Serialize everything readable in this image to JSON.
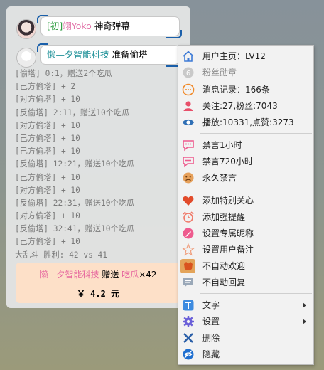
{
  "chat": {
    "messages": [
      {
        "tag": "[初]",
        "nick": "翊Yoko",
        "text": "神奇弹幕"
      },
      {
        "nick": "懒—夕智能科技",
        "text": "准备偷塔"
      }
    ],
    "log_lines": [
      "[偷塔] 0:1，赠送2个吃瓜",
      "[己方偷塔] + 2",
      "[对方偷塔] + 10",
      "[反偷塔] 2:11，赠送10个吃瓜",
      "[对方偷塔] + 10",
      "[己方偷塔] + 10",
      "[己方偷塔] + 10",
      "[反偷塔] 12:21，赠送10个吃瓜",
      "[己方偷塔] + 10",
      "[对方偷塔] + 10",
      "[反偷塔] 22:31，赠送10个吃瓜",
      "[对方偷塔] + 10",
      "[反偷塔] 32:41，赠送10个吃瓜",
      "[己方偷塔] + 10",
      "大乱斗 胜利: 42 vs 41"
    ],
    "gift": {
      "user": "懒—夕智能科技",
      "action": "赠送",
      "item": "吃瓜",
      "count": "×42",
      "amount": "￥ 4.2 元"
    }
  },
  "menu": {
    "items": [
      {
        "label": "用户主页：LV12",
        "icon": "home-icon",
        "color": "#3d7ad6"
      },
      {
        "label": "粉丝勋章",
        "icon": "medal-icon",
        "color": "#c8c8c8",
        "disabled": true
      },
      {
        "label": "消息记录：166条",
        "icon": "chat-log-icon",
        "color": "#f08a2b"
      },
      {
        "label": "关注:27,粉丝:7043",
        "icon": "user-icon",
        "color": "#e8506a"
      },
      {
        "label": "播放:10331,点赞:3273",
        "icon": "eye-icon",
        "color": "#2f6fb5"
      },
      {
        "label": "禁言1小时",
        "icon": "mute-icon",
        "color": "#ee5b8e"
      },
      {
        "label": "禁言720小时",
        "icon": "mute-long-icon",
        "color": "#ee5b8e"
      },
      {
        "label": "永久禁言",
        "icon": "ban-face-icon",
        "color": "#e6a05a"
      },
      {
        "label": "添加特别关心",
        "icon": "heart-icon",
        "color": "#e24b2b"
      },
      {
        "label": "添加强提醒",
        "icon": "alarm-icon",
        "color": "#f07a6a"
      },
      {
        "label": "设置专属昵称",
        "icon": "tag-icon",
        "color": "#ee5b8e"
      },
      {
        "label": "设置用户备注",
        "icon": "note-icon",
        "color": "#f0a080"
      },
      {
        "label": "不自动欢迎",
        "icon": "welcome-icon",
        "color": "#d9531e"
      },
      {
        "label": "不自动回复",
        "icon": "reply-icon",
        "color": "#9aa8b8"
      },
      {
        "label": "文字",
        "icon": "text-icon",
        "color": "#3d8be0",
        "submenu": true
      },
      {
        "label": "设置",
        "icon": "gear-icon",
        "color": "#6a5fd8",
        "submenu": true
      },
      {
        "label": "删除",
        "icon": "close-icon",
        "color": "#2a5fa8"
      },
      {
        "label": "隐藏",
        "icon": "hide-icon",
        "color": "#1f6fd0"
      }
    ]
  }
}
